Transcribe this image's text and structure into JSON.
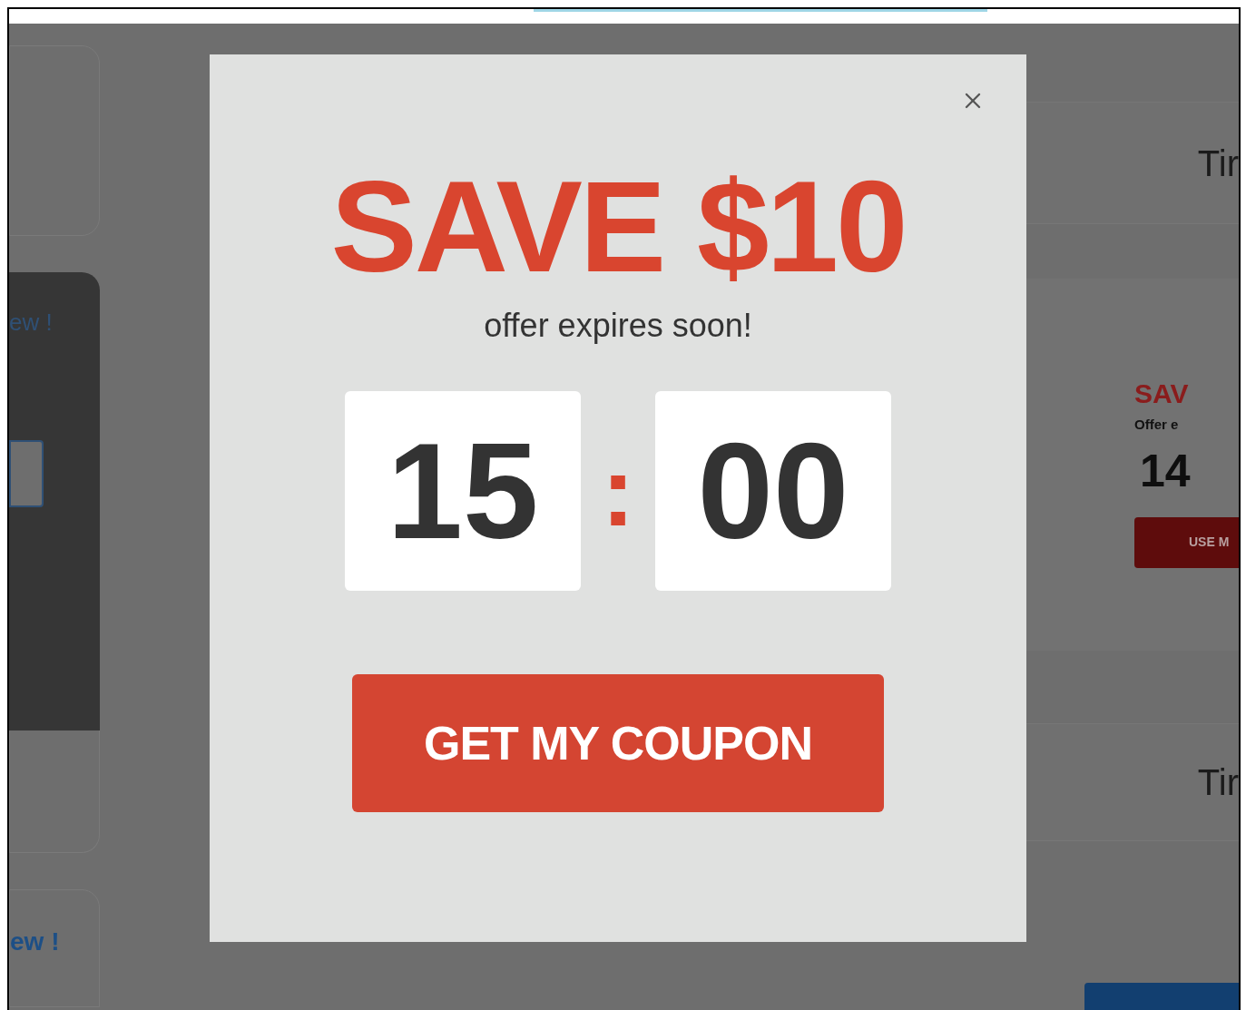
{
  "background_page": {
    "left_panel_heading": "ew !",
    "left_card_heading": "ew !",
    "right_headings": [
      "Tir",
      "Tir"
    ],
    "promo": {
      "title": "SAV",
      "subtitle": "Offer e",
      "timer": "14",
      "button": "USE M"
    }
  },
  "modal": {
    "title": "SAVE $10",
    "subtitle": "offer expires soon!",
    "timer": {
      "minutes": "15",
      "separator": ":",
      "seconds": "00"
    },
    "button": "GET MY COUPON"
  }
}
